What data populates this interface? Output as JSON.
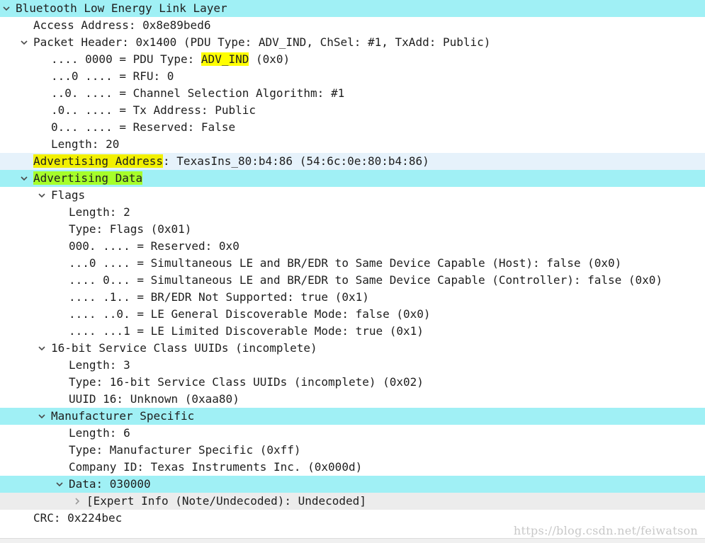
{
  "tree": [
    {
      "depth": 0,
      "expander": "expanded",
      "text": "Bluetooth Low Energy Link Layer",
      "highlight": "cyan"
    },
    {
      "depth": 1,
      "expander": "none",
      "text": "Access Address: 0x8e89bed6"
    },
    {
      "depth": 1,
      "expander": "expanded",
      "text": "Packet Header: 0x1400 (PDU Type: ADV_IND, ChSel: #1, TxAdd: Public)"
    },
    {
      "depth": 2,
      "expander": "none",
      "segments": [
        {
          "text": ".... 0000 = PDU Type: "
        },
        {
          "text": "ADV_IND",
          "mark": "yellow"
        },
        {
          "text": " (0x0)"
        }
      ]
    },
    {
      "depth": 2,
      "expander": "none",
      "text": "...0 .... = RFU: 0"
    },
    {
      "depth": 2,
      "expander": "none",
      "text": "..0. .... = Channel Selection Algorithm: #1"
    },
    {
      "depth": 2,
      "expander": "none",
      "text": ".0.. .... = Tx Address: Public"
    },
    {
      "depth": 2,
      "expander": "none",
      "text": "0... .... = Reserved: False"
    },
    {
      "depth": 2,
      "expander": "none",
      "text": "Length: 20"
    },
    {
      "depth": 1,
      "expander": "none",
      "highlight": "light",
      "segments": [
        {
          "text": "Advertising Address",
          "mark": "yellow-block"
        },
        {
          "text": ": TexasIns_80:b4:86 (54:6c:0e:80:b4:86)"
        }
      ]
    },
    {
      "depth": 1,
      "expander": "expanded",
      "highlight": "cyan",
      "segments": [
        {
          "text": "Advertising Data",
          "mark": "green"
        }
      ]
    },
    {
      "depth": 2,
      "expander": "expanded",
      "text": "Flags"
    },
    {
      "depth": 3,
      "expander": "none",
      "text": "Length: 2"
    },
    {
      "depth": 3,
      "expander": "none",
      "text": "Type: Flags (0x01)"
    },
    {
      "depth": 3,
      "expander": "none",
      "text": "000. .... = Reserved: 0x0"
    },
    {
      "depth": 3,
      "expander": "none",
      "text": "...0 .... = Simultaneous LE and BR/EDR to Same Device Capable (Host): false (0x0)"
    },
    {
      "depth": 3,
      "expander": "none",
      "text": ".... 0... = Simultaneous LE and BR/EDR to Same Device Capable (Controller): false (0x0)"
    },
    {
      "depth": 3,
      "expander": "none",
      "text": ".... .1.. = BR/EDR Not Supported: true (0x1)"
    },
    {
      "depth": 3,
      "expander": "none",
      "text": ".... ..0. = LE General Discoverable Mode: false (0x0)"
    },
    {
      "depth": 3,
      "expander": "none",
      "text": ".... ...1 = LE Limited Discoverable Mode: true (0x1)"
    },
    {
      "depth": 2,
      "expander": "expanded",
      "text": "16-bit Service Class UUIDs (incomplete)"
    },
    {
      "depth": 3,
      "expander": "none",
      "text": "Length: 3"
    },
    {
      "depth": 3,
      "expander": "none",
      "text": "Type: 16-bit Service Class UUIDs (incomplete) (0x02)"
    },
    {
      "depth": 3,
      "expander": "none",
      "text": "UUID 16: Unknown (0xaa80)"
    },
    {
      "depth": 2,
      "expander": "expanded",
      "text": "Manufacturer Specific",
      "highlight": "cyan"
    },
    {
      "depth": 3,
      "expander": "none",
      "text": "Length: 6"
    },
    {
      "depth": 3,
      "expander": "none",
      "text": "Type: Manufacturer Specific (0xff)"
    },
    {
      "depth": 3,
      "expander": "none",
      "text": "Company ID: Texas Instruments Inc. (0x000d)"
    },
    {
      "depth": 3,
      "expander": "expanded",
      "text": "Data: 030000",
      "highlight": "cyan"
    },
    {
      "depth": 4,
      "expander": "collapsed",
      "text": "[Expert Info (Note/Undecoded): Undecoded]",
      "highlight": "grey"
    },
    {
      "depth": 1,
      "expander": "none",
      "text": "CRC: 0x224bec"
    }
  ],
  "watermark": "https://blog.csdn.net/feiwatson",
  "colors": {
    "row_highlight": "#a0f0f5",
    "row_selected_light": "#e6f2fb",
    "row_grey": "#ececec",
    "mark_yellow": "#ffff00",
    "mark_green": "#a6ff2a"
  },
  "icons": {
    "expanded": "chevron-down-icon",
    "collapsed": "chevron-right-icon"
  }
}
